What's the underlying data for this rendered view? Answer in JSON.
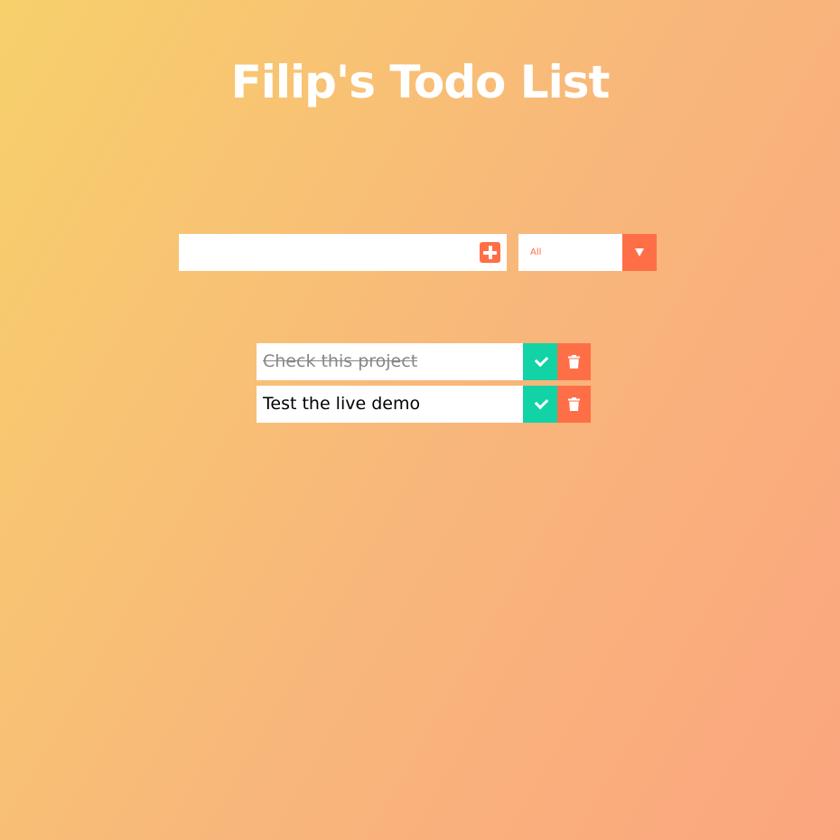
{
  "header": {
    "title": "Filip's Todo List"
  },
  "form": {
    "input_value": "",
    "input_placeholder": "",
    "add_icon": "plus-square-icon"
  },
  "filter": {
    "selected": "All",
    "arrow_icon": "chevron-down-icon"
  },
  "todos": [
    {
      "text": "Check this project",
      "completed": true
    },
    {
      "text": "Test the live demo",
      "completed": false
    }
  ],
  "colors": {
    "accent": "#ff6f47",
    "complete": "#12d3a6",
    "gradient_start": "#f7d06b",
    "gradient_end": "#fba57f"
  }
}
